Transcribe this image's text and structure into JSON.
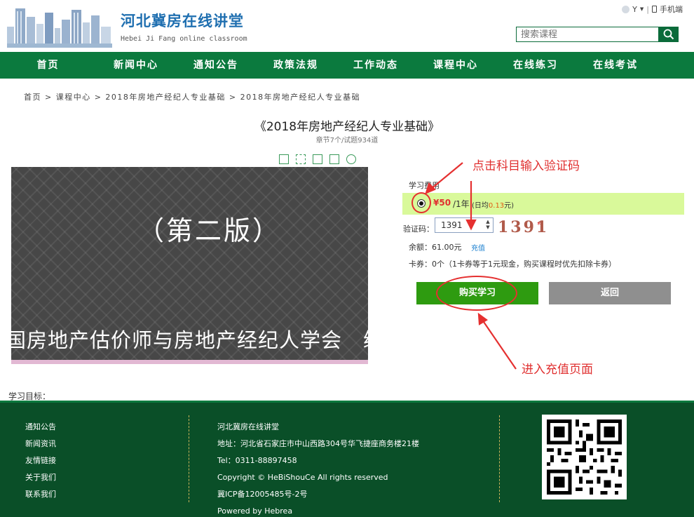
{
  "header": {
    "title": "河北冀房在线讲堂",
    "subtitle": "Hebei Ji Fang online classroom",
    "user_label": "Y",
    "mobile_label": "手机端",
    "search_placeholder": "搜索课程"
  },
  "nav": [
    "首页",
    "新闻中心",
    "通知公告",
    "政策法规",
    "工作动态",
    "课程中心",
    "在线练习",
    "在线考试"
  ],
  "breadcrumb": "首页 > 课程中心 > 2018年房地产经纪人专业基础 > 2018年房地产经纪人专业基础",
  "course": {
    "title": "《2018年房地产经纪人专业基础》",
    "meta": "章节7个/试题934道"
  },
  "video": {
    "edition": "（第二版）",
    "org": "国房地产估价师与房地产经纪人学会　编"
  },
  "purchase": {
    "fee_label": "学习费用",
    "price": "¥50",
    "per": "/1年",
    "daily_prefix": "(日均",
    "daily_value": "0.13",
    "daily_suffix": "元)",
    "code_label": "验证码：",
    "code_value": "1391",
    "captcha": "1391",
    "captcha_mark": "*",
    "balance": "余额：61.00元",
    "recharge": "充值",
    "card": "卡券：0个（1卡券等于1元现金，购买课程时优先扣除卡券）",
    "buy_button": "购买学习",
    "back_button": "返回"
  },
  "annotations": {
    "top": "点击科目输入验证码",
    "bottom": "进入充值页面"
  },
  "goal_label": "学习目标：",
  "footer": {
    "links": [
      "通知公告",
      "新闻资讯",
      "友情链接",
      "关于我们",
      "联系我们"
    ],
    "info": [
      "河北冀房在线讲堂",
      "地址：河北省石家庄市中山西路304号华飞捷座商务楼21楼",
      "Tel：0311-88897458",
      "Copyright © HeBiShouCe All rights reserved",
      "冀ICP备12005485号-2号",
      "Powered by Hebrea"
    ]
  },
  "colors": {
    "nav_green": "#0b7a3e",
    "footer_green": "#0a4f28",
    "price_row": "#d9f99a",
    "buy_green": "#2e9b10",
    "annotation_red": "#e03030"
  }
}
